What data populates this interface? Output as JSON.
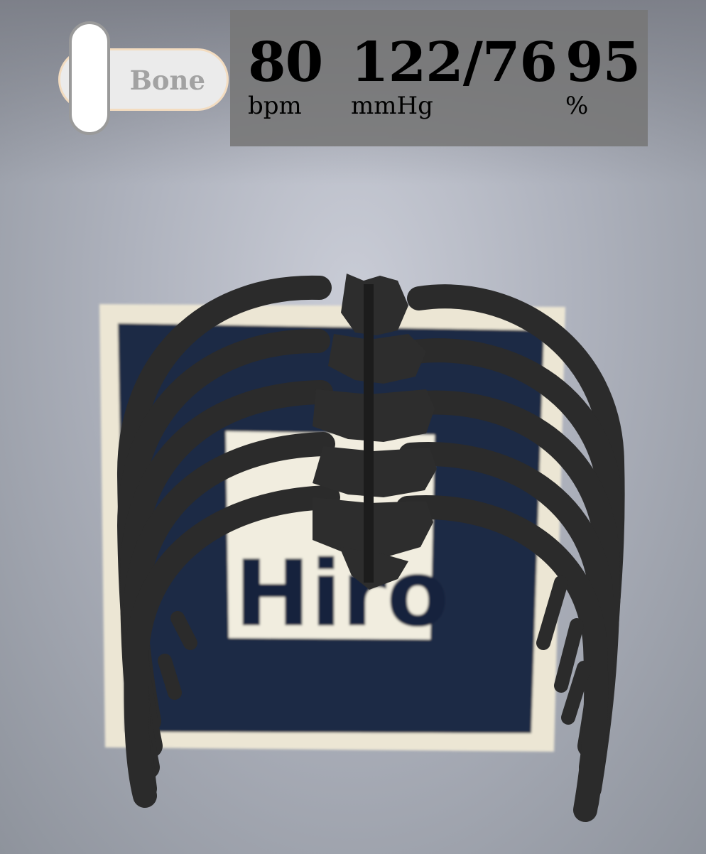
{
  "toggle": {
    "label": "Bone",
    "state": "off"
  },
  "vitals": {
    "heart_rate": {
      "value": "80",
      "unit": "bpm"
    },
    "blood_pressure": {
      "value": "122/76",
      "unit": "mmHg"
    },
    "oxygen_saturation": {
      "value": "95",
      "unit": "%"
    }
  },
  "marker": {
    "text": "Hiro"
  },
  "model": {
    "name": "ribcage",
    "color": "#2a2a2a"
  }
}
